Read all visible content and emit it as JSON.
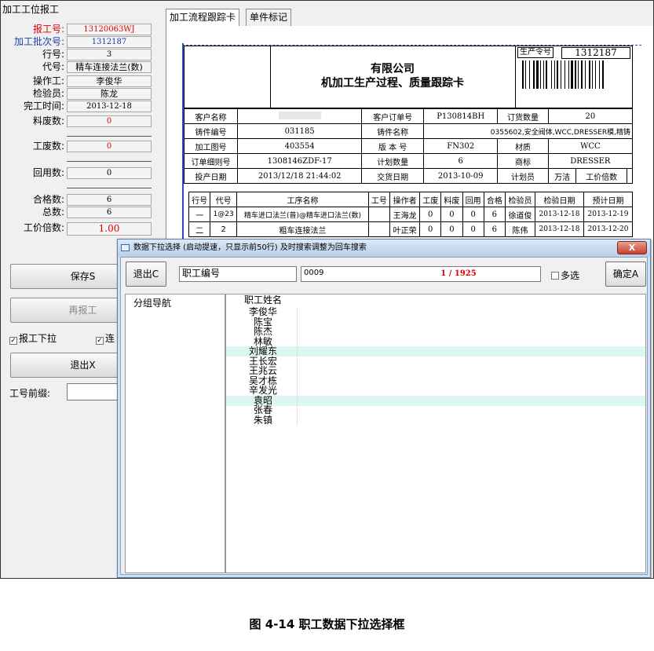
{
  "left": {
    "section_title": "加工工位报工",
    "fields": [
      {
        "label": "报工号:",
        "value": "13120063WJ"
      },
      {
        "label": "加工批次号:",
        "value": "1312187"
      },
      {
        "label": "行号:",
        "value": "3"
      },
      {
        "label": "代号:",
        "value": "精车连接法兰(数)"
      },
      {
        "label": "操作工:",
        "value": "李俊华"
      },
      {
        "label": "检验员:",
        "value": "陈龙"
      },
      {
        "label": "完工时间:",
        "value": "2013-12-18"
      }
    ],
    "scrap_material": {
      "label": "料废数:",
      "value": "0"
    },
    "scrap_work": {
      "label": "工废数:",
      "value": "0"
    },
    "reuse": {
      "label": "回用数:",
      "value": "0"
    },
    "qualified": {
      "label": "合格数:",
      "value": "6"
    },
    "total": {
      "label": "总数:",
      "value": "6"
    },
    "price_multiple": {
      "label": "工价倍数:",
      "value": "1.00"
    },
    "save_button": "保存S",
    "rereport_button": "再报工",
    "check_pulldown": "报工下拉",
    "check_continuous": "连",
    "exit_button": "退出X",
    "prefix_label": "工号前缀:"
  },
  "tabs": [
    "加工流程跟踪卡",
    "单件标记"
  ],
  "card": {
    "company": "有限公司",
    "title": "机加工生产过程、质量跟踪卡",
    "order_label": "生产令号",
    "order_value": "1312187",
    "info_rows": [
      [
        "客户名称",
        "",
        "客户订单号",
        "P130814BH",
        "订货数量",
        "20"
      ],
      [
        "铸件编号",
        "031185",
        "铸件名称",
        "0355602,安全阀体,WCC,DRESSER模,精铸"
      ],
      [
        "加工图号",
        "403554",
        "版 本 号",
        "FN302",
        "材质",
        "WCC"
      ],
      [
        "订单细则号",
        "1308146ZDF-17",
        "计划数量",
        "6",
        "商标",
        "DRESSER"
      ],
      [
        "投产日期",
        "2013/12/18 21:44:02",
        "交货日期",
        "2013-10-09",
        "计划员",
        "万洁",
        "工价倍数",
        ""
      ]
    ],
    "proc_headers": [
      "行号",
      "代号",
      "工序名称",
      "工号",
      "操作者",
      "工废",
      "料废",
      "回用",
      "合格",
      "检验员",
      "检验日期",
      "预计日期"
    ],
    "proc_rows": [
      [
        "一",
        "1@23",
        "精车进口法兰(普)@精车进口法兰(数)",
        "",
        "王海龙",
        "0",
        "0",
        "0",
        "6",
        "徐道俊",
        "2013-12-18",
        "2013-12-19"
      ],
      [
        "二",
        "2",
        "粗车连接法兰",
        "",
        "叶正荣",
        "0",
        "0",
        "0",
        "6",
        "陈伟",
        "2013-12-18",
        "2013-12-20"
      ]
    ]
  },
  "modal": {
    "title": "数据下拉选择 (启动提速，只显示前50行)  及时搜索调整为回车搜索",
    "close": "X",
    "exit_button": "退出C",
    "field_select": "职工编号",
    "search_value": "0009",
    "count": "1 / 1925",
    "multi_label": "多选",
    "ok_button": "确定A",
    "nav_label": "分组导航",
    "column_header": "职工姓名",
    "names": [
      "李俊华",
      "陈宝",
      "陈杰",
      "林敏",
      "刘耀东",
      "王长宏",
      "王兆云",
      "吴才栋",
      "辛发光",
      "袁昭",
      "张春",
      "朱镇"
    ]
  },
  "caption": "图 4-14  职工数据下拉选择框",
  "colors": {
    "accent_red": "#d00000",
    "label_blue": "#1a3ea8",
    "row_highlight": "#dcf6f4",
    "card_border": "#2c4fb8"
  }
}
